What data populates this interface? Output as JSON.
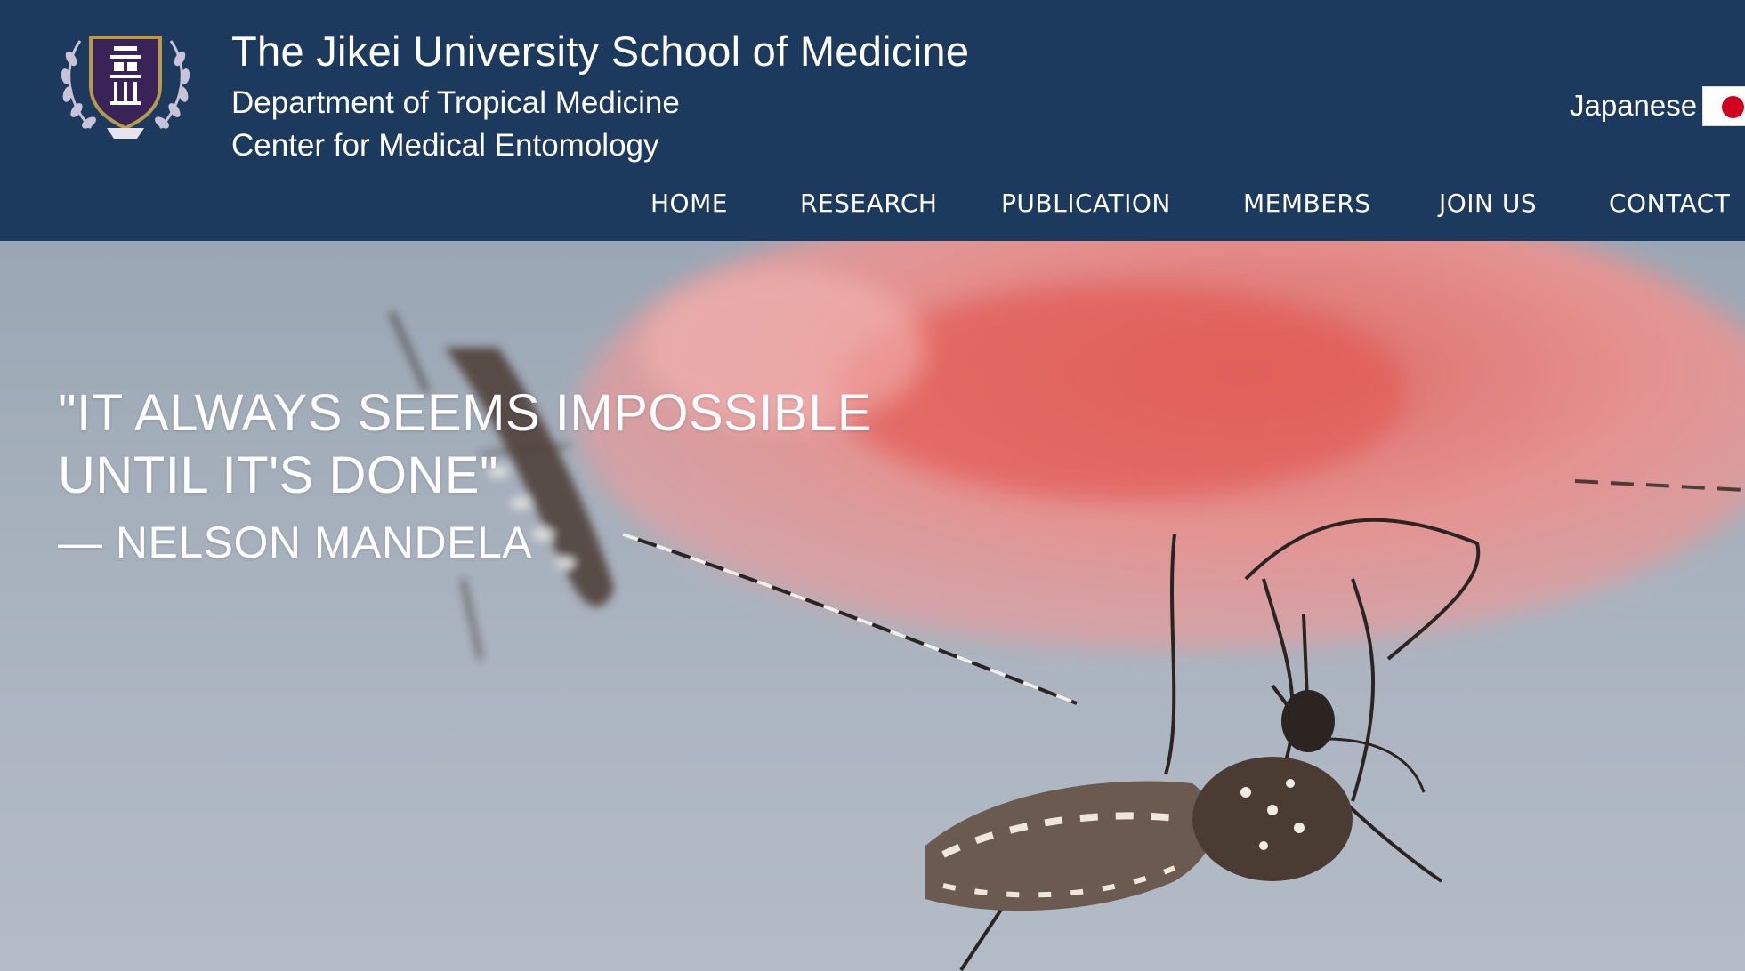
{
  "header": {
    "title": "The Jikei University School of Medicine",
    "subtitle_line1": "Department of Tropical Medicine",
    "subtitle_line2": "Center for Medical Entomology",
    "logo_icon": "university-crest-icon",
    "brand_color": "#1c3a5e"
  },
  "language": {
    "label": "Japanese",
    "flag_icon": "japan-flag-icon"
  },
  "nav": {
    "items": [
      {
        "label": "HOME"
      },
      {
        "label": "RESEARCH"
      },
      {
        "label": "PUBLICATION"
      },
      {
        "label": "MEMBERS"
      },
      {
        "label": "JOIN US"
      },
      {
        "label": "CONTACT"
      }
    ]
  },
  "hero": {
    "quote_line1": "\"IT ALWAYS SEEMS IMPOSSIBLE",
    "quote_line2": "UNTIL IT'S DONE\"",
    "attribution": "— NELSON MANDELA",
    "image_subject": "mosquitoes-feeding-photo"
  }
}
